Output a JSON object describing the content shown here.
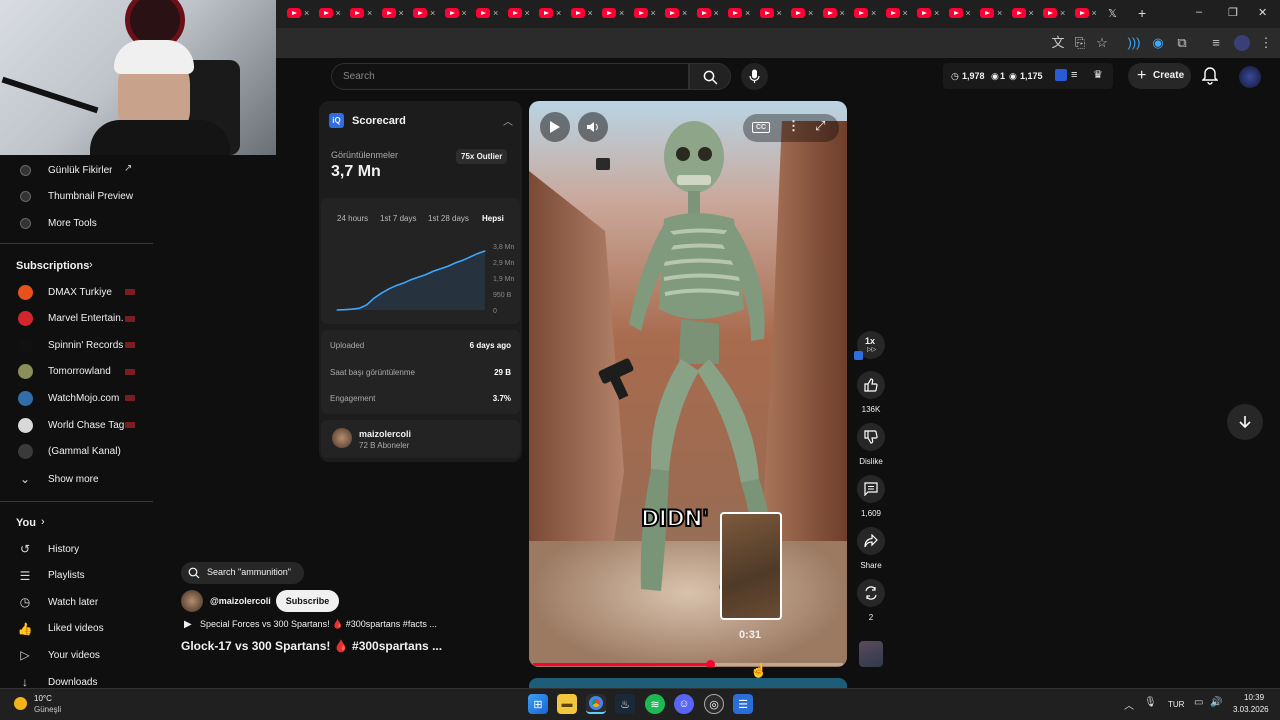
{
  "browser": {
    "tab_close": "×",
    "new_tab": "+",
    "window_controls": [
      "–",
      "❐",
      "✕"
    ]
  },
  "header": {
    "search_placeholder": "Search",
    "stats": {
      "views_1": "1,978",
      "count_1": "1",
      "views_2": "1,175"
    },
    "create_label": "Create"
  },
  "sidebar": {
    "top_items": [
      {
        "label": "Günlük Fikirler",
        "icon": "iq-icon"
      },
      {
        "label": "Thumbnail Preview",
        "icon": "iq-icon"
      },
      {
        "label": "More Tools",
        "icon": "iq-icon"
      }
    ],
    "subscriptions_title": "Subscriptions",
    "subscriptions": [
      {
        "label": "DMAX Turkiye",
        "color": "#e8501c"
      },
      {
        "label": "Marvel Entertain...",
        "color": "#d3252c"
      },
      {
        "label": "Spinnin' Records",
        "color": "#111111"
      },
      {
        "label": "Tomorrowland",
        "color": "#8a8f5a"
      },
      {
        "label": "WatchMojo.com",
        "color": "#2f6ea8"
      },
      {
        "label": "World Chase Tag",
        "color": "#d8d8d8"
      },
      {
        "label": "(Gammal Kanal)",
        "color": "#3a3a3a"
      }
    ],
    "show_more": "Show more",
    "you_title": "You",
    "you_items": [
      {
        "label": "History",
        "icon": "history-icon"
      },
      {
        "label": "Playlists",
        "icon": "playlists-icon"
      },
      {
        "label": "Watch later",
        "icon": "clock-icon"
      },
      {
        "label": "Liked videos",
        "icon": "like-icon"
      },
      {
        "label": "Your videos",
        "icon": "video-icon"
      },
      {
        "label": "Downloads",
        "icon": "download-icon"
      }
    ]
  },
  "scorecard": {
    "title": "Scorecard",
    "views_label": "Görüntülenmeler",
    "views_value": "3,7 Mn",
    "outlier_badge": "75x Outlier",
    "ranges": [
      "24 hours",
      "1st 7 days",
      "1st 28 days",
      "Hepsi"
    ],
    "active_range": "Hepsi",
    "axis_ticks": [
      "3,8 Mn",
      "2,9 Mn",
      "1,9 Mn",
      "950 B",
      "0"
    ],
    "rows": [
      {
        "label": "Uploaded",
        "value": "6 days ago"
      },
      {
        "label": "Saat başı görüntülenme",
        "value": "29 B"
      },
      {
        "label": "Engagement",
        "value": "3.7%"
      }
    ],
    "channel_name": "maizolercoli",
    "channel_subs": "72 B Aboneler"
  },
  "chart_data": {
    "type": "line",
    "x": [
      0,
      1,
      2,
      3,
      4,
      5,
      6,
      7,
      8,
      9,
      10,
      11,
      12,
      13,
      14,
      15,
      16,
      17,
      18,
      19,
      20
    ],
    "y": [
      0,
      0.02,
      0.05,
      0.1,
      0.3,
      0.7,
      1.0,
      1.25,
      1.45,
      1.6,
      1.8,
      1.95,
      2.1,
      2.3,
      2.45,
      2.6,
      2.8,
      2.95,
      3.15,
      3.35,
      3.5
    ],
    "ylim": [
      0,
      3.8
    ],
    "ylabel": "",
    "xlabel": "",
    "title": "",
    "grid": false,
    "color": "#3ea6ff"
  },
  "video": {
    "caption_overlay": "DIDN'",
    "preview_time": "0:31",
    "progress": 0.57,
    "speed_label": "1x",
    "cc_label": "CC"
  },
  "actions": [
    {
      "name": "like",
      "label": "136K",
      "icon": "thumbs-up-icon"
    },
    {
      "name": "dislike",
      "label": "Dislike",
      "icon": "thumbs-down-icon"
    },
    {
      "name": "comments",
      "label": "1,609",
      "icon": "comment-icon"
    },
    {
      "name": "share",
      "label": "Share",
      "icon": "share-icon"
    },
    {
      "name": "remix",
      "label": "2",
      "icon": "remix-icon"
    }
  ],
  "below_video": {
    "search_chip": "Search \"ammunition\"",
    "channel_handle": "@maizolercoli",
    "subscribe_label": "Subscribe",
    "description": "Special Forces vs 300 Spartans! 🩸 #300spartans #facts ...",
    "title": "Glock-17 vs 300 Spartans! 🩸 #300spartans ..."
  },
  "taskbar": {
    "weather_temp": "10°C",
    "weather_text": "Güneşli",
    "lang": "TUR",
    "time": "10:39",
    "date": "3.03.2026"
  }
}
